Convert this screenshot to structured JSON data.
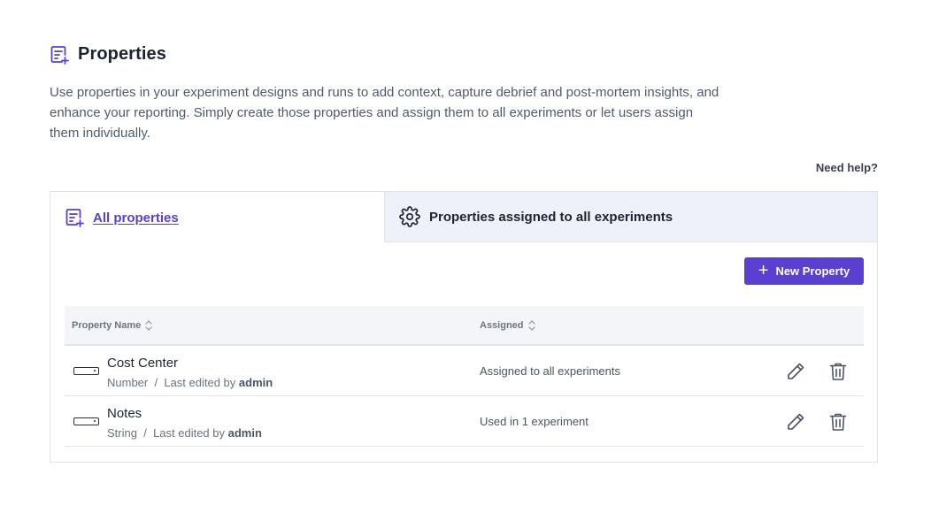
{
  "header": {
    "title": "Properties",
    "icon": "properties-icon"
  },
  "description": "Use properties in your experiment designs and runs to add context, capture debrief and post-mortem insights, and enhance your reporting. Simply create those properties and assign them to all experiments or let users assign them individually.",
  "help_link": "Need help?",
  "tabs": [
    {
      "label": "All properties",
      "icon": "properties-icon",
      "active": true
    },
    {
      "label": "Properties assigned to all experiments",
      "icon": "gear-icon",
      "active": false
    }
  ],
  "new_button": {
    "label": "New Property",
    "icon": "plus-icon"
  },
  "table": {
    "columns": [
      "Property Name",
      "Assigned"
    ],
    "rows": [
      {
        "name": "Cost Center",
        "type": "Number",
        "separator": "/",
        "edited_prefix": "Last edited by",
        "editor": "admin",
        "assigned": "Assigned to all experiments"
      },
      {
        "name": "Notes",
        "type": "String",
        "separator": "/",
        "edited_prefix": "Last edited by",
        "editor": "admin",
        "assigned": "Used in 1 experiment"
      }
    ]
  },
  "colors": {
    "accent": "#5a3fd0",
    "tab_inactive_bg": "#eef1f8",
    "table_header_bg": "#f3f5f9"
  }
}
